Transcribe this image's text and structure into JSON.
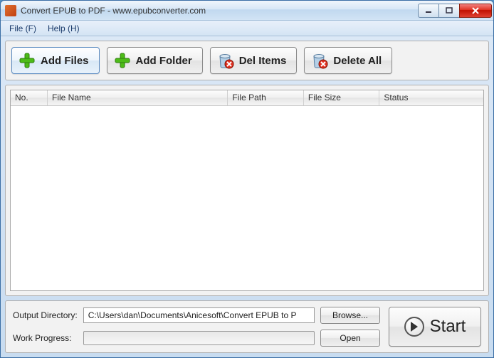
{
  "window": {
    "title": "Convert EPUB to PDF - www.epubconverter.com"
  },
  "menu": {
    "file": "File (F)",
    "help": "Help (H)"
  },
  "toolbar": {
    "add_files": "Add Files",
    "add_folder": "Add Folder",
    "del_items": "Del Items",
    "delete_all": "Delete All"
  },
  "columns": {
    "no": "No.",
    "file_name": "File Name",
    "file_path": "File Path",
    "file_size": "File Size",
    "status": "Status"
  },
  "rows": [],
  "bottom": {
    "output_dir_label": "Output Directory:",
    "output_dir_value": "C:\\Users\\dan\\Documents\\Anicesoft\\Convert EPUB to P",
    "browse": "Browse...",
    "work_progress_label": "Work Progress:",
    "open": "Open",
    "start": "Start"
  },
  "colors": {
    "accent": "#5a9ed6",
    "green": "#4cbb17",
    "red": "#d02010"
  }
}
